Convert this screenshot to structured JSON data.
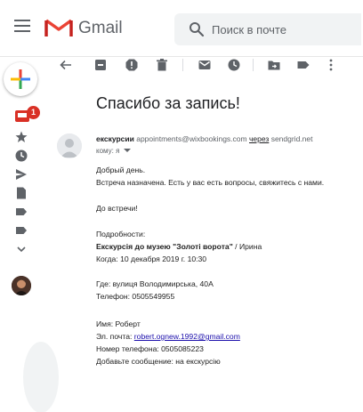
{
  "header": {
    "brand": "Gmail",
    "search_placeholder": "Поиск в почте"
  },
  "rail": {
    "inbox_badge": "1",
    "items": [
      "inbox-icon",
      "star-icon",
      "clock-icon",
      "send-icon",
      "draft-icon",
      "label-icon",
      "label-icon",
      "chevron-down-icon"
    ]
  },
  "toolbar": {
    "icons": [
      "back-arrow-icon",
      "archive-icon",
      "report-spam-icon",
      "delete-icon",
      "mark-unread-icon",
      "snooze-icon",
      "move-to-icon",
      "label-icon",
      "more-vert-icon"
    ]
  },
  "message": {
    "subject": "Спасибо за запись!",
    "sender_name": "екскурсии",
    "sender_email": "appointments@wixbookings.com",
    "via_label": "через",
    "via_domain": "sendgrid.net",
    "to_label": "кому: я",
    "greeting": "Добрый день.",
    "line1": "Встреча назначена. Есть у вас есть вопросы, свяжитесь с нами.",
    "line2": "До встречи!",
    "details_label": "Подробности:",
    "event_name": "Екскурсія до музею \"Золоті ворота\"",
    "event_suffix": " / Ирина",
    "when": "Когда: 10 декабря 2019 г. 10:30",
    "where": "Где: вулиця Володимирська, 40А",
    "phone": "Телефон: 0505549955",
    "name_line": "Имя: Роберт",
    "email_label": "Эл. почта: ",
    "email_value": "robert.ognew.1992@gmail.com",
    "phone_number_line": "Номер телефона: 0505085223",
    "message_line": "Добавьте сообщение: на екскурсію"
  },
  "colors": {
    "gmail_red": "#ea4335",
    "badge": "#d93025",
    "link": "#1a0dab",
    "icon_gray": "#5f6368"
  }
}
